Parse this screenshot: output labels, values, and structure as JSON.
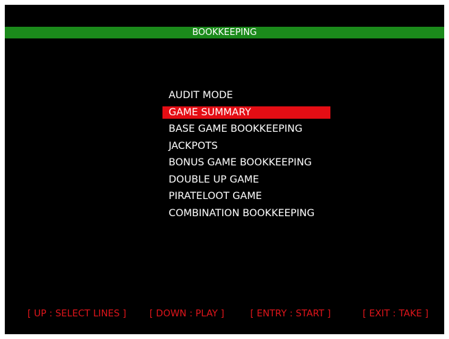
{
  "header": {
    "title": "BOOKKEEPING"
  },
  "menu": {
    "selected_index": 1,
    "items": [
      "AUDIT MODE",
      "GAME SUMMARY",
      "BASE GAME BOOKKEEPING",
      "JACKPOTS",
      "BONUS GAME BOOKKEEPING",
      "DOUBLE UP GAME",
      "PIRATELOOT GAME",
      "COMBINATION BOOKKEEPING"
    ]
  },
  "footer": {
    "hints": [
      "[ UP : SELECT LINES ]",
      "[ DOWN : PLAY ]",
      "[ ENTRY : START ]",
      "[ EXIT : TAKE ]"
    ]
  },
  "colors": {
    "header_bar": "#1b8a1b",
    "highlight": "#e40d14",
    "footer_text": "#e0151b",
    "background": "#000000"
  }
}
